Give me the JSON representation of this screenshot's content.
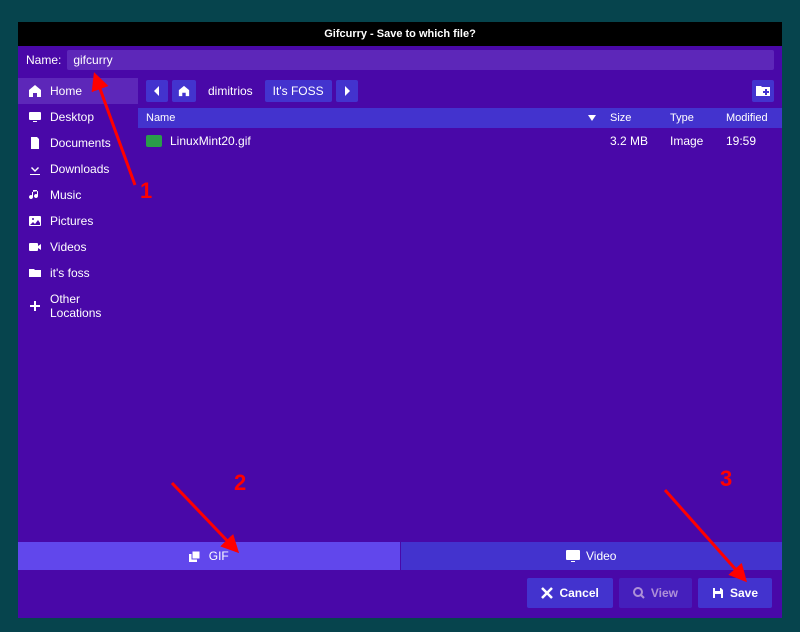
{
  "titlebar": "Gifcurry - Save to which file?",
  "name_label": "Name:",
  "name_value": "gifcurry",
  "sidebar": [
    {
      "label": "Home",
      "icon": "home",
      "selected": true
    },
    {
      "label": "Desktop",
      "icon": "desktop"
    },
    {
      "label": "Documents",
      "icon": "documents"
    },
    {
      "label": "Downloads",
      "icon": "downloads"
    },
    {
      "label": "Music",
      "icon": "music"
    },
    {
      "label": "Pictures",
      "icon": "pictures"
    },
    {
      "label": "Videos",
      "icon": "videos"
    },
    {
      "label": "it's foss",
      "icon": "folder"
    },
    {
      "label": "Other Locations",
      "icon": "plus"
    }
  ],
  "breadcrumb": {
    "segments": [
      "dimitrios",
      "It's FOSS"
    ]
  },
  "columns": {
    "name": "Name",
    "size": "Size",
    "type": "Type",
    "modified": "Modified"
  },
  "files": [
    {
      "name": "LinuxMint20.gif",
      "size": "3.2 MB",
      "type": "Image",
      "modified": "19:59"
    }
  ],
  "tabs": {
    "gif": "GIF",
    "video": "Video"
  },
  "actions": {
    "cancel": "Cancel",
    "view": "View",
    "save": "Save"
  },
  "annotations": {
    "n1": "1",
    "n2": "2",
    "n3": "3"
  }
}
